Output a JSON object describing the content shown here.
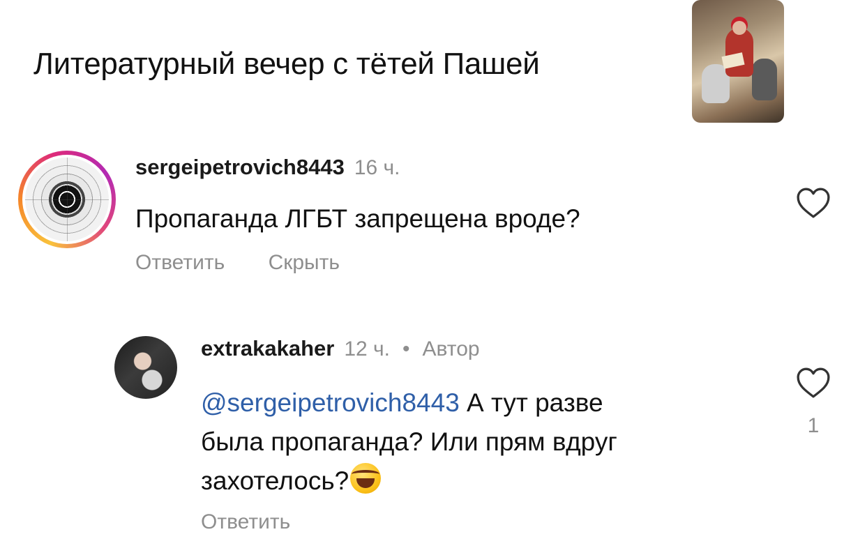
{
  "post": {
    "caption": "Литературный вечер с тётей Пашей"
  },
  "comments": [
    {
      "username": "sergeipetrovich8443",
      "time": "16 ч.",
      "text": "Пропаганда ЛГБТ запрещена вроде?",
      "actions": {
        "reply": "Ответить",
        "hide": "Скрыть"
      }
    },
    {
      "username": "extrakakaher",
      "time": "12 ч.",
      "separator": "•",
      "badge": "Автор",
      "mention": "@sergeipetrovich8443",
      "text_line1": " А тут разве",
      "text_line2": "была пропаганда? Или прям вдруг",
      "text_line3": "захотелось?",
      "emoji": "face-with-tears-of-joy",
      "like_count": "1",
      "actions": {
        "reply": "Ответить"
      }
    }
  ],
  "icons": {
    "like": "heart-outline-icon",
    "story_ring_colors": [
      "#f9c23c",
      "#f58529",
      "#dd2a7b",
      "#b32ab3"
    ]
  },
  "colors": {
    "mention": "#2f5fa8",
    "muted": "#8e8e8e",
    "text": "#111111"
  }
}
